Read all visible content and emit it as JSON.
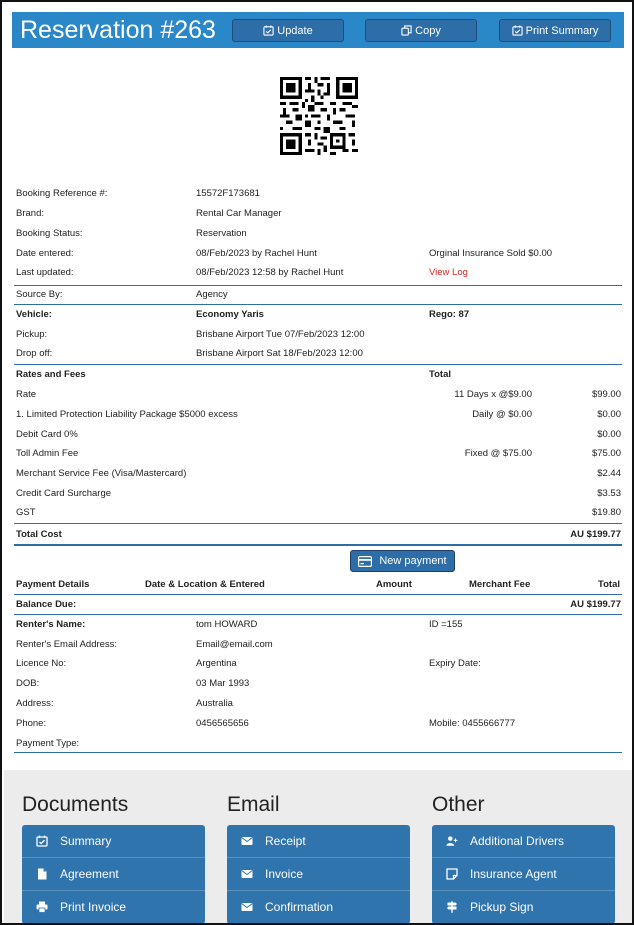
{
  "header": {
    "title": "Reservation #263",
    "buttons": {
      "update": "Update",
      "copy": "Copy",
      "print_summary": "Print Summary"
    }
  },
  "booking": {
    "reference_label": "Booking Reference #:",
    "reference_value": "15572F173681",
    "brand_label": "Brand:",
    "brand_value": "Rental Car Manager",
    "status_label": "Booking Status:",
    "status_value": "Reservation",
    "date_entered_label": "Date entered:",
    "date_entered_value": "08/Feb/2023 by Rachel Hunt",
    "insurance_note": "Orginal Insurance Sold $0.00",
    "last_updated_label": "Last updated:",
    "last_updated_value": "08/Feb/2023 12:58 by Rachel Hunt",
    "view_log": "View Log",
    "source_label": "Source By:",
    "source_value": "Agency"
  },
  "vehicle": {
    "vehicle_label": "Vehicle:",
    "vehicle_value": "Economy Yaris",
    "rego": "Rego: 87",
    "pickup_label": "Pickup:",
    "pickup_value": "Brisbane Airport Tue 07/Feb/2023 12:00",
    "dropoff_label": "Drop off:",
    "dropoff_value": "Brisbane Airport Sat 18/Feb/2023 12:00"
  },
  "fees": {
    "heading": "Rates and Fees",
    "total_heading": "Total",
    "items": [
      {
        "name": "Rate",
        "detail": "11 Days x @$9.00",
        "amount": "$99.00"
      },
      {
        "name": "1. Limited Protection Liability Package $5000 excess",
        "detail": "Daily @ $0.00",
        "amount": "$0.00"
      },
      {
        "name": "Debit Card 0%",
        "detail": "",
        "amount": "$0.00"
      },
      {
        "name": "Toll Admin Fee",
        "detail": "Fixed @ $75.00",
        "amount": "$75.00"
      },
      {
        "name": "Merchant Service Fee (Visa/Mastercard)",
        "detail": "",
        "amount": "$2.44"
      },
      {
        "name": "Credit Card Surcharge",
        "detail": "",
        "amount": "$3.53"
      },
      {
        "name": "GST",
        "detail": "",
        "amount": "$19.80"
      }
    ],
    "total_cost_label": "Total Cost",
    "total_cost_value": "AU $199.77"
  },
  "payment": {
    "new_payment_button": "New payment",
    "headers": {
      "details": "Payment Details",
      "date_location": "Date & Location & Entered",
      "amount": "Amount",
      "merchant_fee": "Merchant Fee",
      "total": "Total"
    },
    "balance_label": "Balance Due:",
    "balance_value": "AU $199.77"
  },
  "renter": {
    "name_label": "Renter's Name:",
    "name_value": "tom HOWARD",
    "id_value": "ID =155",
    "email_label": "Renter's Email Address:",
    "email_value": "Email@email.com",
    "licence_label": "Licence No:",
    "licence_value": "Argentina",
    "expiry_label": "Expiry Date:",
    "dob_label": "DOB:",
    "dob_value": "03 Mar 1993",
    "address_label": "Address:",
    "address_value": "Australia",
    "phone_label": "Phone:",
    "phone_value": "0456565656",
    "mobile_value": "Mobile: 0455666777",
    "payment_type_label": "Payment Type:"
  },
  "sections": {
    "documents": {
      "title": "Documents",
      "items": [
        "Summary",
        "Agreement",
        "Print Invoice"
      ]
    },
    "email": {
      "title": "Email",
      "items": [
        "Receipt",
        "Invoice",
        "Confirmation"
      ]
    },
    "other": {
      "title": "Other",
      "items": [
        "Additional Drivers",
        "Insurance Agent",
        "Pickup Sign"
      ]
    }
  },
  "icons": {
    "update": "calendar-check-icon",
    "copy": "copy-icon",
    "print_summary": "calendar-check-icon",
    "new_payment": "credit-card-icon",
    "documents": [
      "calendar-check-icon",
      "file-icon",
      "print-icon"
    ],
    "email": [
      "envelope-icon",
      "envelope-icon",
      "envelope-icon"
    ],
    "other": [
      "user-plus-icon",
      "note-icon",
      "signpost-icon"
    ]
  },
  "colors": {
    "header": "#2a87c8",
    "button": "#2d6ea8",
    "menu": "#2f74ad",
    "link": "#d9261c",
    "panel": "#ececec"
  }
}
